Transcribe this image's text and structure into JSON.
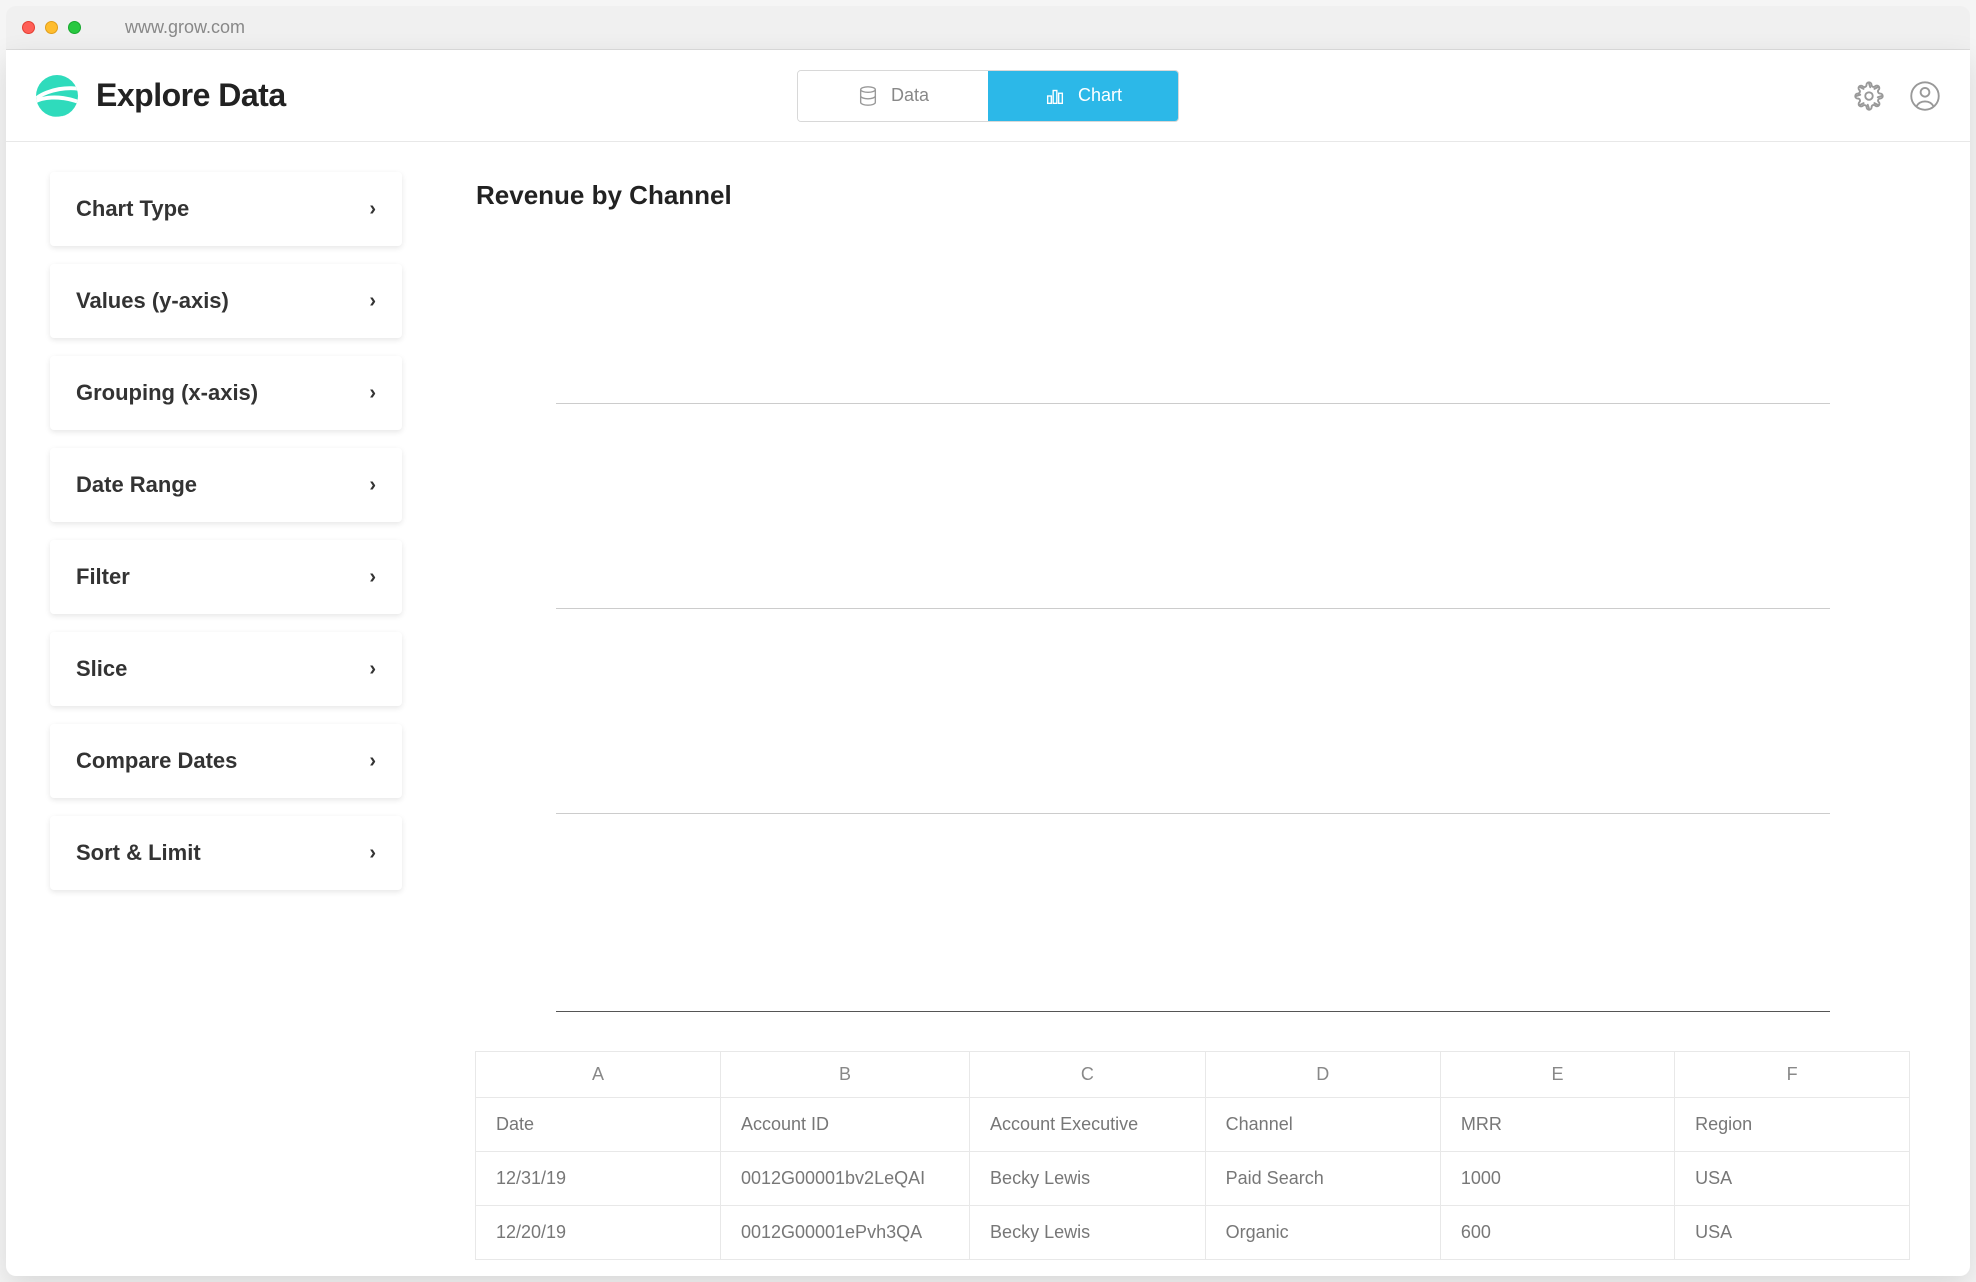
{
  "browser": {
    "url": "www.grow.com"
  },
  "header": {
    "title": "Explore Data",
    "tabs": {
      "data_label": "Data",
      "chart_label": "Chart"
    }
  },
  "sidebar": {
    "items": [
      {
        "label": "Chart Type"
      },
      {
        "label": "Values (y-axis)"
      },
      {
        "label": "Grouping (x-axis)"
      },
      {
        "label": "Date Range"
      },
      {
        "label": "Filter"
      },
      {
        "label": "Slice"
      },
      {
        "label": "Compare Dates"
      },
      {
        "label": "Sort & Limit"
      }
    ]
  },
  "content": {
    "title": "Revenue by Channel"
  },
  "table": {
    "columns": [
      "A",
      "B",
      "C",
      "D",
      "E",
      "F"
    ],
    "header_row": [
      "Date",
      "Account ID",
      "Account Executive",
      "Channel",
      "MRR",
      "Region"
    ],
    "rows": [
      [
        "12/31/19",
        "0012G00001bv2LeQAI",
        "Becky Lewis",
        "Paid Search",
        "1000",
        "USA"
      ],
      [
        "12/20/19",
        "0012G00001ePvh3QA",
        "Becky Lewis",
        "Organic",
        "600",
        "USA"
      ]
    ]
  }
}
